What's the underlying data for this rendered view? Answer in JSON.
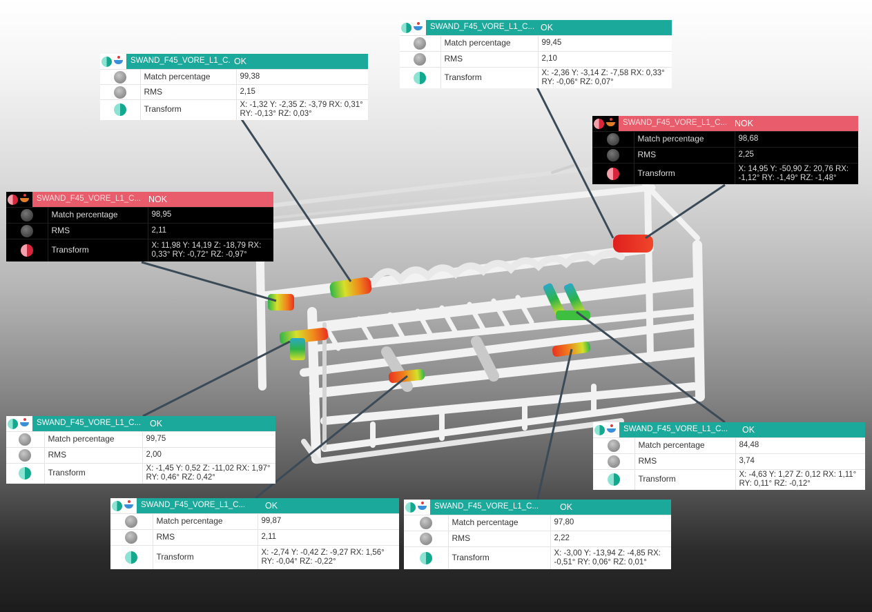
{
  "labels": {
    "match": "Match percentage",
    "rms": "RMS",
    "transform": "Transform"
  },
  "colors": {
    "ok_header": "#1aa99a",
    "nok_header": "#e95c6c",
    "ok_body": "#ffffff",
    "nok_body": "#000000",
    "connector": "#3b4a57"
  },
  "icons": {
    "status_ok": "teal-half-circle-icon",
    "status_nok": "red-half-circle-icon",
    "part": "target-icon",
    "metric": "gray-circle-icon"
  },
  "panels": [
    {
      "id": "p1",
      "name": "SWAND_F45_VORE_L1_C...",
      "status": "OK",
      "match": "99,38",
      "rms": "2,15",
      "transform_1": "X: -1,32 Y: -2,35 Z: -3,79 RX: 0,31°",
      "transform_2": "RY: -0,13° RZ: 0,03°"
    },
    {
      "id": "p2",
      "name": "SWAND_F45_VORE_L1_C...",
      "status": "OK",
      "match": "99,45",
      "rms": "2,10",
      "transform_1": "X: -2,36 Y: -3,14 Z: -7,58 RX: 0,33°",
      "transform_2": "RY: -0,06° RZ: 0,07°"
    },
    {
      "id": "p3",
      "name": "SWAND_F45_VORE_L1_C...",
      "status": "NOK",
      "match": "98,68",
      "rms": "2,25",
      "transform_1": "X: 14,95 Y: -50,90 Z: 20,76 RX:",
      "transform_2": "-1,12° RY: -1,49° RZ: -1,48°"
    },
    {
      "id": "p4",
      "name": "SWAND_F45_VORE_L1_C...",
      "status": "NOK",
      "match": "98,95",
      "rms": "2,11",
      "transform_1": "X: 11,98 Y: 14,19 Z: -18,79 RX:",
      "transform_2": "0,33° RY: -0,72° RZ: -0,97°"
    },
    {
      "id": "p5",
      "name": "SWAND_F45_VORE_L1_C...",
      "status": "OK",
      "match": "99,75",
      "rms": "2,00",
      "transform_1": "X: -1,45 Y: 0,52 Z: -11,02 RX: 1,97°",
      "transform_2": "RY: 0,46° RZ: 0,42°"
    },
    {
      "id": "p6",
      "name": "SWAND_F45_VORE_L1_C...",
      "status": "OK",
      "match": "84,48",
      "rms": "3,74",
      "transform_1": "X: -4,63 Y: 1,27 Z: 0,12 RX: 1,11°",
      "transform_2": "RY: 0,11° RZ: -0,12°"
    },
    {
      "id": "p7",
      "name": "SWAND_F45_VORE_L1_C...",
      "status": "OK",
      "match": "99,87",
      "rms": "2,11",
      "transform_1": "X: -2,74 Y: -0,42 Z: -9,27 RX: 1,56°",
      "transform_2": "RY: -0,04° RZ: -0,22°"
    },
    {
      "id": "p8",
      "name": "SWAND_F45_VORE_L1_C...",
      "status": "OK",
      "match": "97,80",
      "rms": "2,22",
      "transform_1": "X: -3,00 Y: -13,94 Z: -4,85 RX:",
      "transform_2": "-0,51° RY: 0,06° RZ: 0,01°"
    }
  ]
}
